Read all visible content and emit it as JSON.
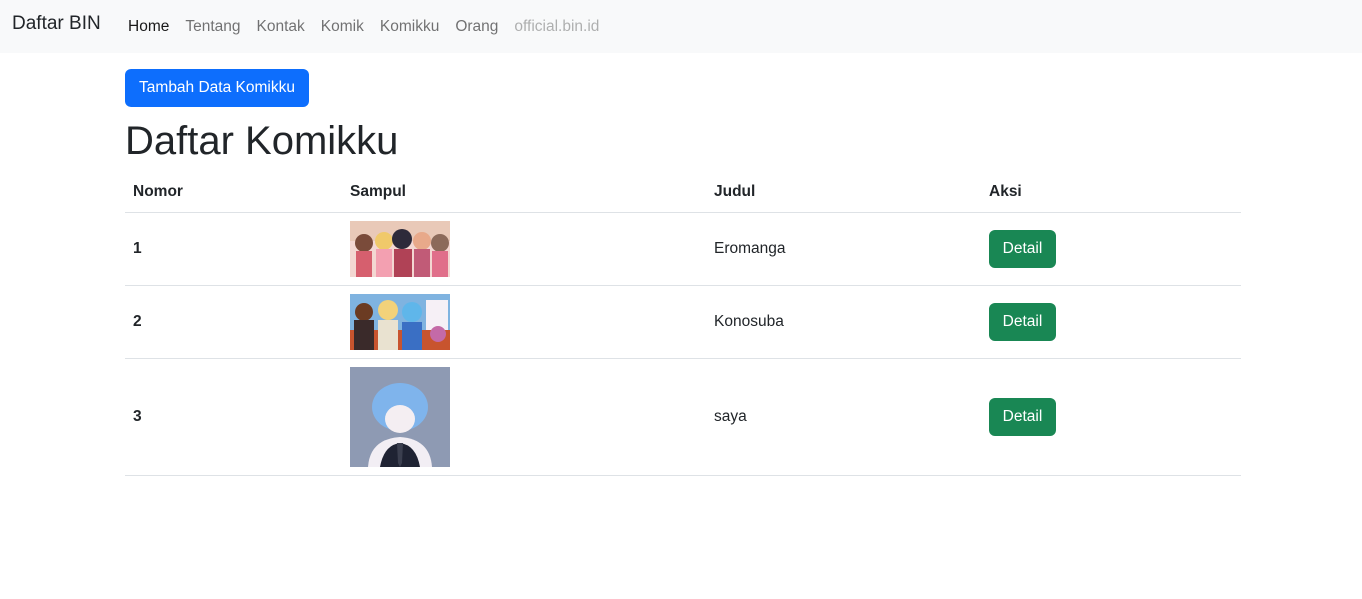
{
  "navbar": {
    "brand": "Daftar BIN",
    "links": [
      {
        "label": "Home"
      },
      {
        "label": "Tentang"
      },
      {
        "label": "Kontak"
      },
      {
        "label": "Komik"
      },
      {
        "label": "Komikku"
      },
      {
        "label": "Orang"
      },
      {
        "label": "official.bin.id"
      }
    ]
  },
  "main": {
    "add_button": "Tambah Data Komikku",
    "title": "Daftar Komikku",
    "table": {
      "headers": [
        "Nomor",
        "Sampul",
        "Judul",
        "Aksi"
      ],
      "rows": [
        {
          "nomor": "1",
          "judul": "Eromanga",
          "action": "Detail"
        },
        {
          "nomor": "2",
          "judul": "Konosuba",
          "action": "Detail"
        },
        {
          "nomor": "3",
          "judul": "saya",
          "action": "Detail"
        }
      ]
    }
  },
  "colors": {
    "primary": "#0d6efd",
    "success": "#198754",
    "navbar_bg": "#f8f9fa"
  }
}
